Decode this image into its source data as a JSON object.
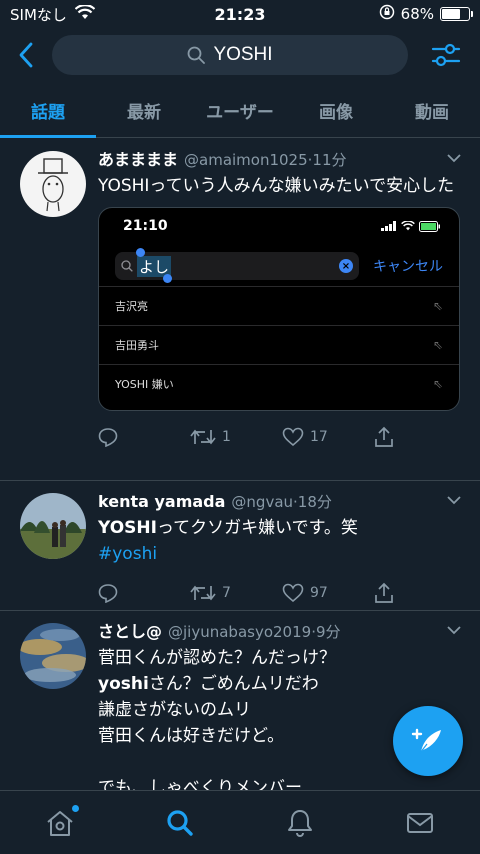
{
  "status_bar": {
    "carrier": "SIMなし",
    "time": "21:23",
    "battery_percent": "68%",
    "battery_level": 0.68
  },
  "search": {
    "query": "YOSHI"
  },
  "tabs": [
    {
      "label": "話題",
      "active": true
    },
    {
      "label": "最新",
      "active": false
    },
    {
      "label": "ユーザー",
      "active": false
    },
    {
      "label": "画像",
      "active": false
    },
    {
      "label": "動画",
      "active": false
    }
  ],
  "tweets": [
    {
      "name": "あまままま",
      "handle": "@amaimon1025",
      "time": "·11分",
      "text": "YOSHIっていう人みんな嫌いみたいで安心した",
      "replies": "",
      "retweets": "1",
      "likes": "17",
      "media": {
        "time": "21:10",
        "search_text": "よし",
        "cancel": "キャンセル",
        "suggestions": [
          "吉沢亮",
          "吉田勇斗",
          "YOSHI 嫌い"
        ]
      }
    },
    {
      "name": "kenta yamada",
      "handle": "@ngvau",
      "time": "·18分",
      "text_bold": "YOSHI",
      "text_rest": "ってクソガキ嫌いです。笑",
      "hashtag": "#yoshi",
      "replies": "",
      "retweets": "7",
      "likes": "97"
    },
    {
      "name": "さとし@",
      "handle": "@jiyunabasyo2019",
      "time": "·9分",
      "line1": "菅田くんが認めた？んだっけ？",
      "line2_bold": "yoshi",
      "line2_rest": "さん？ごめんムリだわ",
      "line3": "謙虚さがないのムリ",
      "line4": "菅田くんは好きだけど。",
      "line5": "でも、しゃべくりメンバー"
    }
  ],
  "colors": {
    "background": "#15202b",
    "accent": "#1da1f2",
    "muted": "#8899a6",
    "divider": "#38444d"
  }
}
